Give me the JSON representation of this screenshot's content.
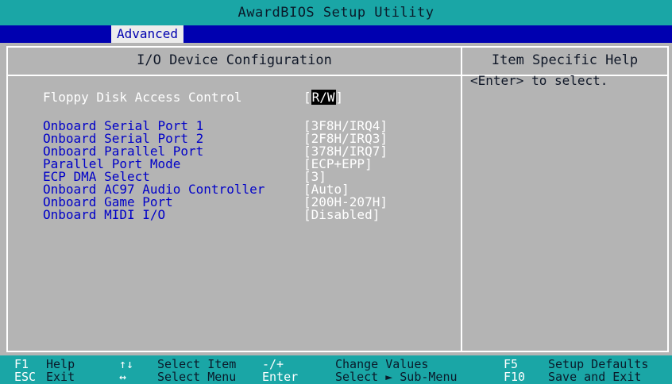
{
  "app_title": "AwardBIOS Setup Utility",
  "menu": {
    "active_tab": "Advanced"
  },
  "panel": {
    "title": "I/O Device Configuration",
    "help_title": "Item Specific Help",
    "help_text": "<Enter> to select."
  },
  "items": [
    {
      "label": "Floppy Disk Access Control",
      "value_prefix": "[",
      "value": "R/W",
      "value_suffix": "]"
    },
    {
      "label": "Onboard Serial Port 1",
      "value": "[3F8H/IRQ4]"
    },
    {
      "label": "Onboard Serial Port 2",
      "value": "[2F8H/IRQ3]"
    },
    {
      "label": "Onboard Parallel Port",
      "value": "[378H/IRQ7]"
    },
    {
      "label": "Parallel Port Mode",
      "value": "[ECP+EPP]"
    },
    {
      "label": "ECP DMA Select",
      "value": "[3]"
    },
    {
      "label": "Onboard AC97 Audio Controller",
      "value": "[Auto]"
    },
    {
      "label": "Onboard Game Port",
      "value": "[200H-207H]"
    },
    {
      "label": "Onboard MIDI I/O",
      "value": "[Disabled]"
    }
  ],
  "status": {
    "f1_key": "F1",
    "f1_desc": "Help",
    "esc_key": "ESC",
    "esc_desc": "Exit",
    "updown_key": "↑↓",
    "updown_desc": "Select Item",
    "leftright_key": "↔",
    "leftright_desc": "Select Menu",
    "minusplus_key": "-/+",
    "minusplus_desc": "Change Values",
    "enter_key": "Enter",
    "enter_desc": "Select ► Sub-Menu",
    "f5_key": "F5",
    "f5_desc": "Setup Defaults",
    "f10_key": "F10",
    "f10_desc": "Save and Exit"
  },
  "colors": {
    "title_bar": "#1aa6a6",
    "menu_bar": "#0000b0",
    "panel_bg": "#b4b4b4",
    "item_text": "#0000c8",
    "value_text": "#ffffff"
  }
}
